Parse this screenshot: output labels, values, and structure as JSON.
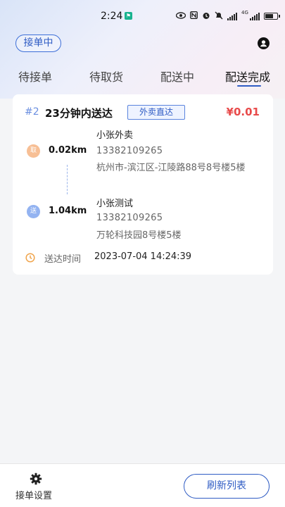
{
  "status_bar": {
    "time": "2:24",
    "notification_icon": "app-notification-icon",
    "icons": [
      "eye-icon",
      "nfc-icon",
      "alarm-icon",
      "mute-icon",
      "wifi-icon",
      "signal-icon",
      "battery-icon"
    ],
    "network_label": "4G",
    "battery_level": 0.7
  },
  "header": {
    "status_chip": "接单中",
    "user_icon": "user-icon"
  },
  "tabs": [
    {
      "label": "待接单"
    },
    {
      "label": "待取货"
    },
    {
      "label": "配送中"
    },
    {
      "label": "配送完成"
    }
  ],
  "active_tab_index": 3,
  "colors": {
    "accent": "#2f5cc4",
    "price": "#e84a4a",
    "pickup_badge": "#f7bf95",
    "deliver_badge": "#93b3f1",
    "clock": "#f0a44b"
  },
  "order": {
    "number": "#2",
    "title": "23分钟内送达",
    "tag": "外卖直达",
    "price": "¥0.01",
    "pickup": {
      "badge": "取",
      "distance": "0.02km",
      "name": "小张外卖",
      "phone": "13382109265",
      "address": "杭州市-滨江区-江陵路88号8号楼5楼"
    },
    "delivery": {
      "badge": "送",
      "distance": "1.04km",
      "name": "小张测试",
      "phone": "13382109265",
      "address": "万轮科技园8号楼5楼"
    },
    "time_label": "送达时间",
    "time_value": "2023-07-04 14:24:39",
    "time_icon": "clock-icon"
  },
  "bottom_bar": {
    "settings_label": "接单设置",
    "settings_icon": "gear-icon",
    "refresh_label": "刷新列表"
  }
}
